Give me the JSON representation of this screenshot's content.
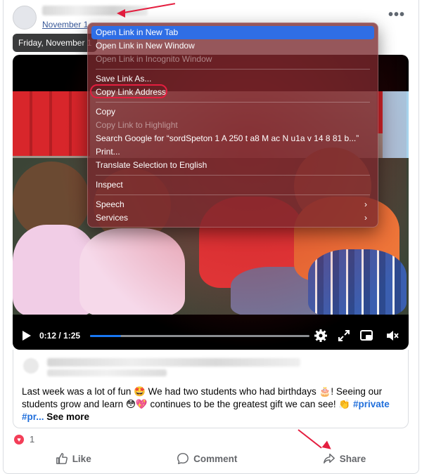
{
  "post": {
    "date": "November 1",
    "tooltip": "Friday, November 1",
    "more": "•••"
  },
  "context_menu": {
    "items": [
      {
        "label": "Open Link in New Tab",
        "state": "highlighted"
      },
      {
        "label": "Open Link in New Window",
        "state": "normal"
      },
      {
        "label": "Open Link in Incognito Window",
        "state": "disabled"
      },
      {
        "label": "Save Link As...",
        "state": "normal"
      },
      {
        "label": "Copy Link Address",
        "state": "circled"
      },
      {
        "label": "Copy",
        "state": "normal"
      },
      {
        "label": "Copy Link to Highlight",
        "state": "disabled"
      },
      {
        "label": "Search Google for “sordSpeton 1 A 250 t a8 M ac  N u1a v 14 8 81 b...”",
        "state": "normal"
      },
      {
        "label": "Print...",
        "state": "normal"
      },
      {
        "label": "Translate Selection to English",
        "state": "normal"
      },
      {
        "label": "Inspect",
        "state": "normal"
      },
      {
        "label": "Speech",
        "state": "submenu"
      },
      {
        "label": "Services",
        "state": "submenu"
      }
    ],
    "submenu_arrow": "›"
  },
  "video": {
    "time": "0:12 / 1:25",
    "progress": 0.14
  },
  "caption": {
    "line1a": "Last week was a lot of fun ",
    "emoji1": "🤩",
    "line1b": " We had two students who had birthdays ",
    "emoji2": "🎂",
    "line1c": "! Seeing our students grow and learn ",
    "emoji3": "😳💖",
    "line1d": " continues to be the greatest gift we can see! ",
    "emoji4": "👏",
    "hashtag1": "#private",
    "hashtag2": "#pr...",
    "see_more": "See more"
  },
  "reactions": {
    "count": "1"
  },
  "actions": {
    "like": "Like",
    "comment": "Comment",
    "share": "Share"
  },
  "colors": {
    "highlight": "#2f6ee5",
    "annotation_red": "#e41e3f",
    "link_blue": "#216fdb"
  }
}
